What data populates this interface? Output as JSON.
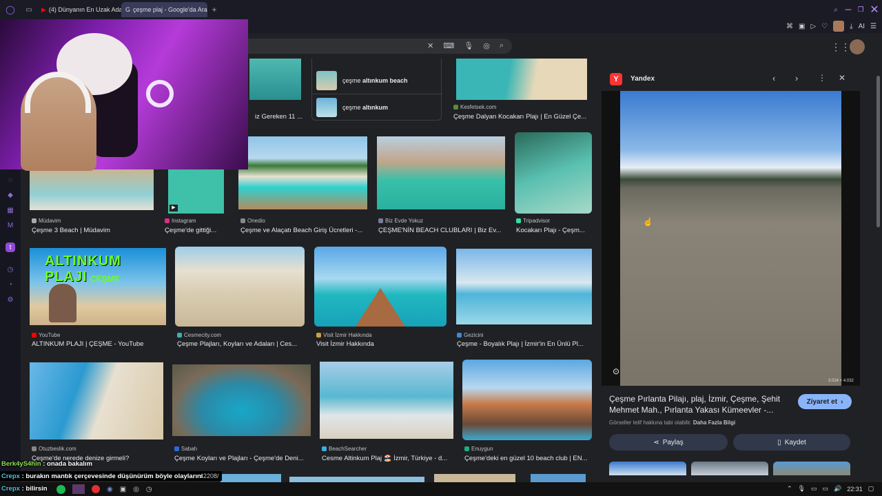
{
  "tabs": [
    {
      "label": "(4) Dünyanın En Uzak Ada"
    },
    {
      "label": "çeşme plaj - Google'da Ara"
    }
  ],
  "toolbar": {
    "ai_label": "AI"
  },
  "suggestions": [
    {
      "prefix": "çeşme ",
      "bold": "altınkum beach"
    },
    {
      "prefix": "çeşme ",
      "bold": "altınkum"
    }
  ],
  "row0": [
    {
      "source": "",
      "caption": "iz Gereken 11 ..."
    },
    {
      "source": "Kesfetsek.com",
      "caption": "Çeşme Dalyan Kocakarı Plajı | En Güzel Çe..."
    }
  ],
  "row1": [
    {
      "source": "Müdavim",
      "caption": "Çeşme 3 Beach | Müdavim"
    },
    {
      "source": "Instagram",
      "caption": "Çeşme'de gittiği..."
    },
    {
      "source": "Onedio",
      "caption": "Çeşme ve Alaçatı Beach Giriş Ücretleri -..."
    },
    {
      "source": "Biz Evde Yokuz",
      "caption": "ÇEŞME'NİN BEACH CLUBLARI | Biz Ev..."
    },
    {
      "source": "Tripadvisor",
      "caption": "Kocakarı Plajı - Çeşm..."
    }
  ],
  "row2": [
    {
      "source": "YouTube",
      "caption": "ALTINKUM PLAJI | ÇEŞME - YouTube",
      "thumb_title": "ALTINKUM PLAJI",
      "thumb_sub": "ÇEŞME"
    },
    {
      "source": "Cesmecity.com",
      "caption": "Çeşme Plajları, Koyları ve Adaları | Ces..."
    },
    {
      "source": "Visit İzmir Hakkında",
      "caption": "Visit İzmir Hakkında"
    },
    {
      "source": "Gezicini",
      "caption": "Çeşme - Boyalık Plajı | İzmir'in En Ünlü Pl..."
    }
  ],
  "row3": [
    {
      "source": "Otuzbeslik.com",
      "caption": "Çeşme'de nerede denize girmeli?"
    },
    {
      "source": "Sabah",
      "caption": "Çeşme Koyları ve Plajları - Çeşme'de Deni..."
    },
    {
      "source": "BeachSearcher",
      "caption": "Cesme Altinkum Plaj 🏖️ İzmir, Türkiye - d..."
    },
    {
      "source": "Enuygun",
      "caption": "Çeşme'deki en güzel 10 beach club | EN..."
    }
  ],
  "panel": {
    "provider": "Yandex",
    "dims": "3.024 × 4.032",
    "title": "Çeşme Pırlanta Pilajı, plaj, İzmir, Çeşme, Şehit Mehmet Mah., Pırlanta Yakası Kümeevler -...",
    "visit": "Ziyaret et",
    "copyright": "Görseller telif hakkına tabi olabilir.",
    "more": "Daha Fazla Bilgi",
    "share": "Paylaş",
    "save": "Kaydet"
  },
  "chat": [
    {
      "user": "Berk4yS4hin",
      "msg": "onada bakalım",
      "color": "#8be04c"
    },
    {
      "user": "Crepx",
      "msg": "burakın mantık çerçevesinde düşünürüm böyle olaylarını",
      "color": "#4cc3e0"
    },
    {
      "user": "Crepx",
      "msg": "bilirsin",
      "color": "#4cc3e0"
    }
  ],
  "chat_extra": "42208/",
  "clock": "22:31"
}
